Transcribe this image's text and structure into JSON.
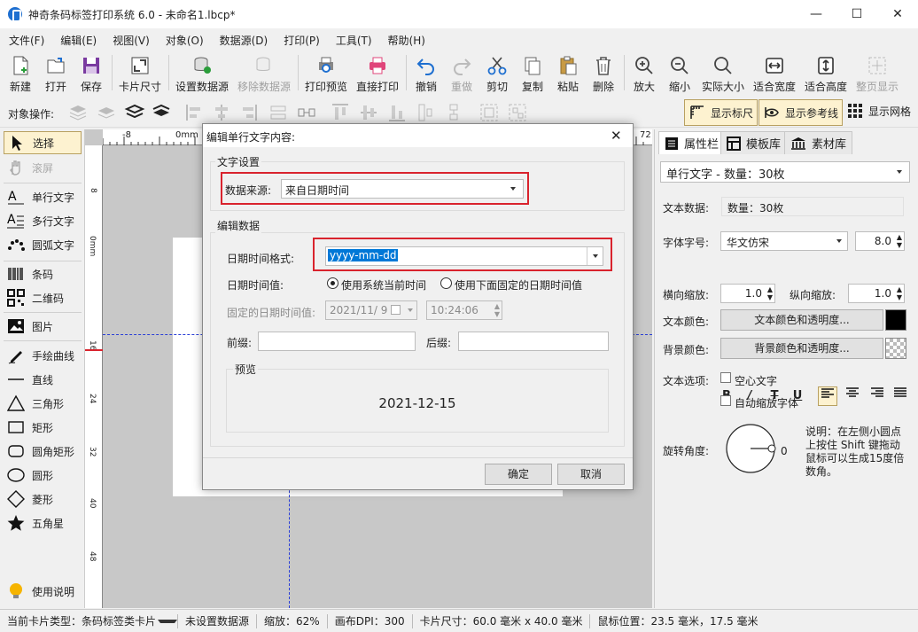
{
  "window": {
    "title": "神奇条码标签打印系统 6.0 - 未命名1.lbcp*"
  },
  "menu": [
    "文件(F)",
    "编辑(E)",
    "视图(V)",
    "对象(O)",
    "数据源(D)",
    "打印(P)",
    "工具(T)",
    "帮助(H)"
  ],
  "toolbar": {
    "new": "新建",
    "open": "打开",
    "save": "保存",
    "card_size": "卡片尺寸",
    "set_datasource": "设置数据源",
    "remove_datasource": "移除数据源",
    "print_preview": "打印预览",
    "direct_print": "直接打印",
    "undo": "撤销",
    "redo": "重做",
    "cut": "剪切",
    "copy": "复制",
    "paste": "粘贴",
    "delete": "删除",
    "zoom_in": "放大",
    "zoom_out": "缩小",
    "actual_size": "实际大小",
    "fit_width": "适合宽度",
    "fit_height": "适合高度",
    "fit_page": "整页显示"
  },
  "objrow": {
    "label": "对象操作:",
    "show_ruler": "显示标尺",
    "show_guides": "显示参考线",
    "show_grid": "显示网格"
  },
  "tools": [
    "选择",
    "滚屏",
    "单行文字",
    "多行文字",
    "圆弧文字",
    "条码",
    "二维码",
    "图片",
    "手绘曲线",
    "直线",
    "三角形",
    "矩形",
    "圆角矩形",
    "圆形",
    "菱形",
    "五角星",
    "使用说明"
  ],
  "ruler": {
    "h": [
      "-8",
      "0mm",
      "72"
    ],
    "v": [
      "8",
      "0mm",
      "16",
      "24",
      "32",
      "40",
      "48"
    ]
  },
  "panel": {
    "tabs": [
      "属性栏",
      "模板库",
      "素材库"
    ],
    "object_select": "单行文字 - 数量：30枚",
    "text_data_label": "文本数据:",
    "text_data_value": "数量：30枚",
    "font_label": "字体字号:",
    "font_name": "华文仿宋",
    "font_size": "8.0",
    "hscale_label": "横向缩放:",
    "hscale": "1.0",
    "vscale_label": "纵向缩放:",
    "vscale": "1.0",
    "text_color_label": "文本颜色:",
    "text_color_btn": "文本颜色和透明度...",
    "bg_color_label": "背景颜色:",
    "bg_color_btn": "背景颜色和透明度...",
    "text_opts_label": "文本选项:",
    "opt_hollow": "空心文字",
    "opt_autoscale": "自动缩放字体",
    "rotate_label": "旋转角度:",
    "rotate_value": "0",
    "rotate_hint": "说明：在左侧小圆点上按住 Shift 键拖动鼠标可以生成15度倍数角。"
  },
  "status": {
    "card_type": "当前卡片类型：条码标签类卡片",
    "datasource": "未设置数据源",
    "zoom": "缩放：62%",
    "dpi": "画布DPI：300",
    "card_size": "卡片尺寸：60.0 毫米 x 40.0 毫米",
    "mouse": "鼠标位置：23.5 毫米，17.5 毫米"
  },
  "dialog": {
    "title": "编辑单行文字内容:",
    "group_text": "文字设置",
    "datasource_label": "数据来源:",
    "datasource_value": "来自日期时间",
    "group_edit": "编辑数据",
    "format_label": "日期时间格式:",
    "format_value": "yyyy-mm-dd",
    "value_label": "日期时间值:",
    "radio_current": "使用系统当前时间",
    "radio_fixed": "使用下面固定的日期时间值",
    "fixed_label": "固定的日期时间值:",
    "fixed_date": "2021/11/  9",
    "fixed_time": "10:24:06",
    "prefix_label": "前缀:",
    "suffix_label": "后缀:",
    "preview_label": "预览",
    "preview_value": "2021-12-15",
    "ok": "确定",
    "cancel": "取消"
  },
  "colors": {
    "highlight_red": "#d9232d",
    "selection_blue": "#0078d7",
    "guide_blue": "#2a3fd6"
  }
}
